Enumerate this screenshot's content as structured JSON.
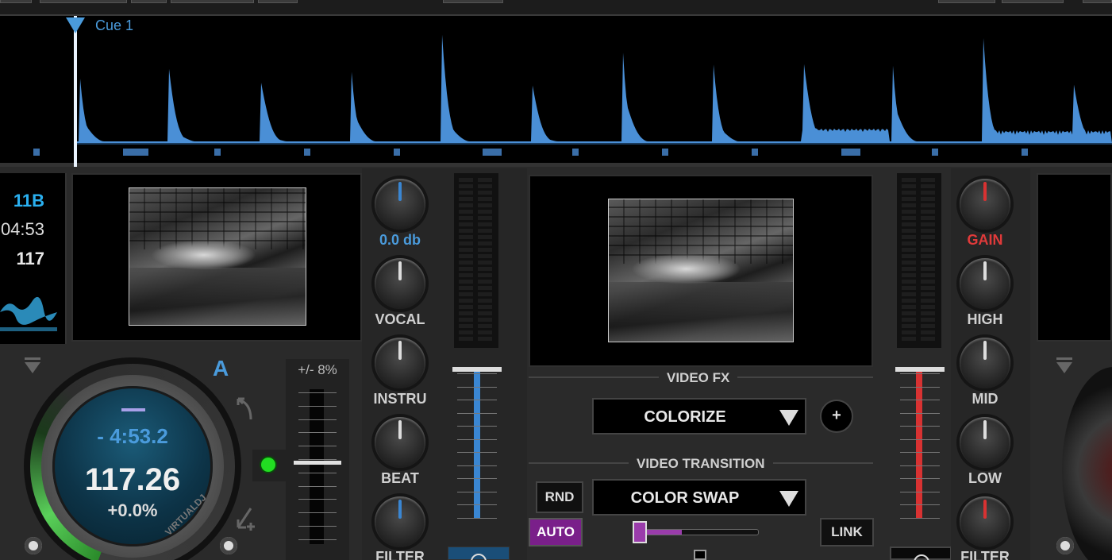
{
  "waveform": {
    "cue_label": "Cue 1",
    "color": "#4a8fd6"
  },
  "deck_a": {
    "deck_letter": "A",
    "key": "11B",
    "length": "04:53",
    "bpm_rounded": "117",
    "remaining_time": "- 4:53.2",
    "bpm": "117.26",
    "pitch": "+0.0%",
    "pitch_range": "+/- 8%",
    "jog_brand": "VIRTUALDJ"
  },
  "mixer": {
    "left_channel": {
      "gain_value": "0.0 db",
      "knobs": [
        "VOCAL",
        "INSTRU",
        "BEAT",
        "FILTER"
      ]
    },
    "right_channel": {
      "knobs": [
        "GAIN",
        "HIGH",
        "MID",
        "LOW",
        "FILTER"
      ]
    },
    "colors": {
      "left": "#3a86d2",
      "right": "#d83232",
      "auto": "#7a1f8a"
    }
  },
  "video": {
    "fx_title": "VIDEO FX",
    "fx_selected": "COLORIZE",
    "add_fx_label": "+",
    "transition_title": "VIDEO TRANSITION",
    "transition_selected": "COLOR SWAP",
    "rnd_label": "RND",
    "auto_label": "AUTO",
    "link_label": "LINK",
    "crossfader_level": 0.35
  },
  "icons": {
    "deck_menu": "triangle-down-icon",
    "pitch_up": "pitch-bend-up-icon",
    "pitch_down": "pitch-bend-down-icon",
    "sync_indicator": "green-led-icon"
  }
}
